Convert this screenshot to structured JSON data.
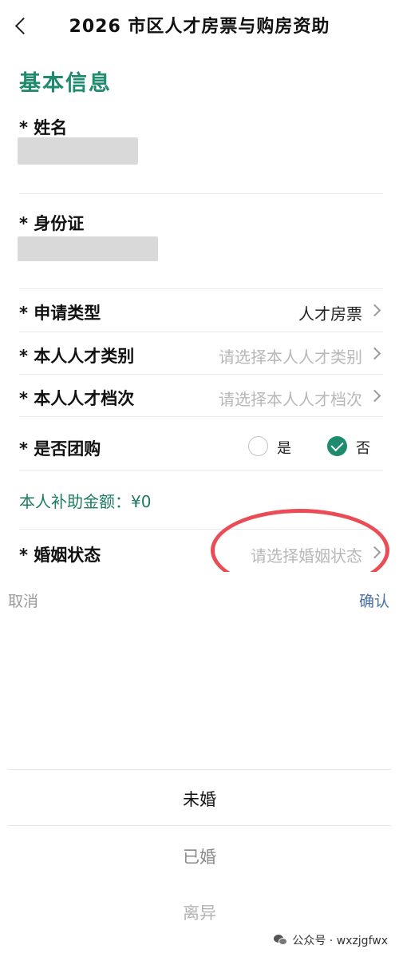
{
  "header": {
    "title": "2026 市区人才房票与购房资助"
  },
  "section": {
    "title": "基本信息"
  },
  "fields": {
    "name_label": "* 姓名",
    "id_label": "* 身份证",
    "apply_type": {
      "label": "* 申请类型",
      "value": "人才房票"
    },
    "talent_category": {
      "label": "* 本人人才类别",
      "placeholder": "请选择本人人才类别"
    },
    "talent_level": {
      "label": "* 本人人才档次",
      "placeholder": "请选择本人人才档次"
    },
    "group_purchase": {
      "label": "* 是否团购",
      "options": [
        "是",
        "否"
      ],
      "selected": "否"
    },
    "subsidy_amount": "本人补助金额：¥0",
    "marital_status": {
      "label": "* 婚姻状态",
      "placeholder": "请选择婚姻状态"
    }
  },
  "picker": {
    "cancel_label": "取消",
    "confirm_label": "确认",
    "options": [
      "未婚",
      "已婚",
      "离异"
    ],
    "selected": "未婚"
  },
  "watermark": {
    "text": "公众号 · wxzjgfwx",
    "icon": "wechat-icon"
  },
  "colors": {
    "accent": "#1e8a6e",
    "highlight": "#ea4d56",
    "confirm": "#4a6fa0"
  }
}
